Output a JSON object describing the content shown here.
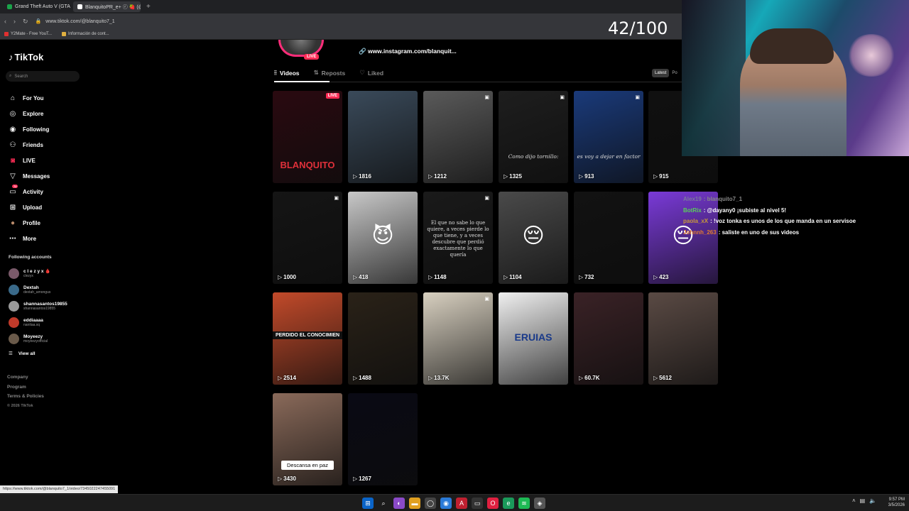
{
  "browser": {
    "tabs": [
      {
        "title": "Grand Theft Auto V (GTA)",
        "color": "#1aa34a",
        "active": false
      },
      {
        "title": "BlanquitoPR_e+ ⓡ 🍓 (@",
        "color": "#ffffff",
        "active": true
      }
    ],
    "url": "www.tiktok.com/@blanquito7_1",
    "bookmarks": [
      {
        "label": "Y2Mate - Free YouT...",
        "color": "#e03030"
      },
      {
        "label": "Información de cont...",
        "color": "#e0b040"
      }
    ]
  },
  "counter": "42/100",
  "tiktok": {
    "logo": "TikTok",
    "search_placeholder": "Search",
    "nav": [
      {
        "label": "For You",
        "icon": "home-icon",
        "glyph": "⌂"
      },
      {
        "label": "Explore",
        "icon": "compass-icon",
        "glyph": "◎"
      },
      {
        "label": "Following",
        "icon": "following-icon",
        "glyph": "◉"
      },
      {
        "label": "Friends",
        "icon": "friends-icon",
        "glyph": "⚇"
      },
      {
        "label": "LIVE",
        "icon": "live-icon",
        "glyph": "◙"
      },
      {
        "label": "Messages",
        "icon": "messages-icon",
        "glyph": "▽"
      },
      {
        "label": "Activity",
        "icon": "activity-icon",
        "glyph": "▭",
        "badge": "72"
      },
      {
        "label": "Upload",
        "icon": "upload-icon",
        "glyph": "⊞"
      },
      {
        "label": "Profile",
        "icon": "profile-avatar-icon",
        "glyph": "●"
      },
      {
        "label": "More",
        "icon": "more-icon",
        "glyph": "⋯"
      }
    ],
    "following_title": "Following accounts",
    "following": [
      {
        "name": "c l e z y x 🩸",
        "handle": "clezyx",
        "color": "#7a5a6a"
      },
      {
        "name": "Dextah",
        "handle": "dextah_amongus",
        "color": "#3a6a8a"
      },
      {
        "name": "shannasantos19855",
        "handle": "shannasantos19855",
        "color": "#9a9a9a"
      },
      {
        "name": "eddiaaaa",
        "handle": "nanitaa.xq",
        "color": "#c03a2a"
      },
      {
        "name": "Moyeezy",
        "handle": "moyeezyofficial",
        "color": "#6a5a4a"
      }
    ],
    "view_all": "View all",
    "footer": [
      "Company",
      "Program",
      "Terms & Policies"
    ],
    "copyright": "© 2026 TikTok",
    "profile": {
      "live_label": "LIVE",
      "instagram": "www.instagram.com/blanquit..."
    },
    "tabs": [
      {
        "label": "Videos",
        "icon": "grid-icon",
        "glyph": "⦙⦙",
        "active": true
      },
      {
        "label": "Reposts",
        "icon": "repost-icon",
        "glyph": "⇅",
        "active": false
      },
      {
        "label": "Liked",
        "icon": "liked-icon",
        "glyph": "♡",
        "active": false
      }
    ],
    "sort": [
      "Latest",
      "Po"
    ],
    "videos": [
      {
        "views": "",
        "bg": "#2a0a10",
        "label": "BLANQUITO",
        "live": "LIVE"
      },
      {
        "views": "1816",
        "bg": "#3a4a5a"
      },
      {
        "views": "1212",
        "bg": "#5a5a5a",
        "pinned": true
      },
      {
        "views": "1325",
        "bg": "#1e1e1e",
        "pinned": true,
        "caption": "Como dijo tornillo:"
      },
      {
        "views": "913",
        "bg": "#1a3a7a",
        "pinned": true,
        "caption": "es voy a dejar en factor"
      },
      {
        "views": "915",
        "bg": "#101010"
      },
      {
        "views": "1000",
        "bg": "#151515",
        "pinned": true
      },
      {
        "views": "418",
        "bg": "#c8c8c8",
        "emoji": "😈"
      },
      {
        "views": "1148",
        "bg": "#1a1a1a",
        "pinned": true,
        "caption": "El que no sabe lo que quiere, a veces pierde lo que tiene, y a veces descubre que perdió exactamente lo que quería"
      },
      {
        "views": "1104",
        "bg": "#4a4a4a",
        "emoji": "😔"
      },
      {
        "views": "732",
        "bg": "#121212"
      },
      {
        "views": "423",
        "bg": "#7a3ad8",
        "emoji": "😔"
      },
      {
        "views": "2514",
        "bg": "#c24a2a",
        "caption": "PERDIDO EL CONOCIMIEN"
      },
      {
        "views": "1488",
        "bg": "#2a2218"
      },
      {
        "views": "13.7K",
        "bg": "#d8d0c0",
        "pinned": true
      },
      {
        "views": "",
        "bg": "#f0f0f0",
        "caption": "ERUIAS"
      },
      {
        "views": "60.7K",
        "bg": "#3a2226"
      },
      {
        "views": "5612",
        "bg": "#5a4a44"
      },
      {
        "views": "3430",
        "bg": "#8a6a5a",
        "caption": "Descansa en paz"
      },
      {
        "views": "1267",
        "bg": "#0a0a14"
      }
    ]
  },
  "stream_chat": [
    {
      "user": "Alex19",
      "user_class": "u1",
      "text": ": blanquito7_1",
      "dim": true
    },
    {
      "user": "BotRix",
      "user_class": "u2",
      "text": ": @dayany0 ¡subiste al nivel 5!"
    },
    {
      "user": "paola_xX",
      "user_class": "u3",
      "text": ": !voz tonka es unos de los que manda en un servisoe"
    },
    {
      "user": "Johnnh_263",
      "user_class": "u4",
      "text": ": saliste en uno de sus videos"
    }
  ],
  "status_url": "https://www.tiktok.com/@blanquito7_1/video/7345022247455091",
  "taskbar": {
    "time": "9:57 PM",
    "date": "3/5/2026"
  }
}
